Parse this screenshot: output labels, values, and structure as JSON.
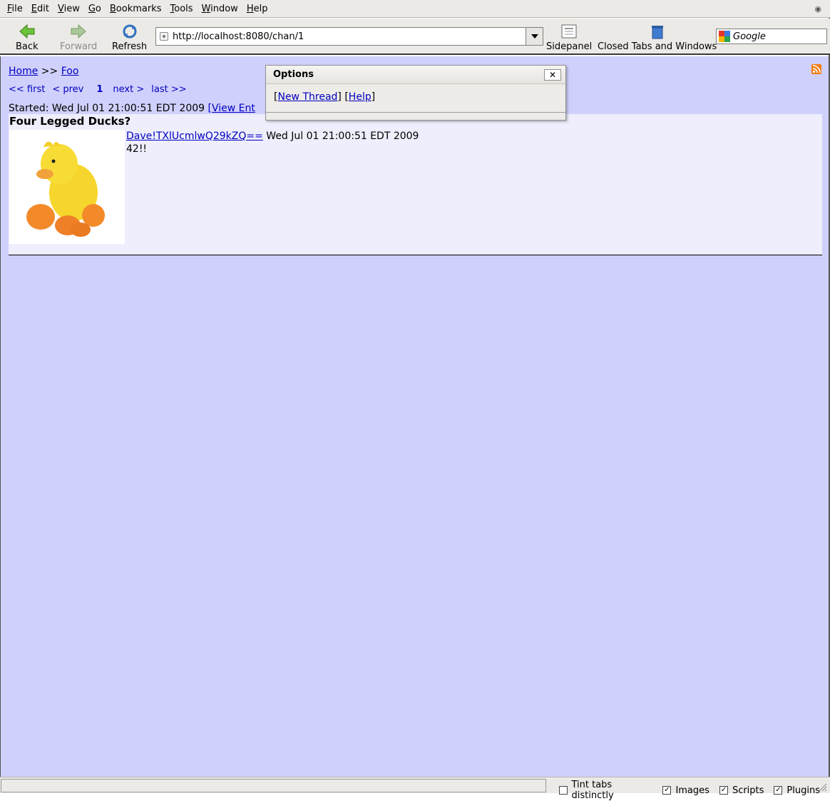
{
  "menubar": {
    "items": [
      {
        "key": "F",
        "rest": "ile"
      },
      {
        "key": "E",
        "rest": "dit"
      },
      {
        "key": "V",
        "rest": "iew"
      },
      {
        "key": "G",
        "rest": "o"
      },
      {
        "key": "B",
        "rest": "ookmarks"
      },
      {
        "key": "T",
        "rest": "ools"
      },
      {
        "key": "W",
        "rest": "indow"
      },
      {
        "key": "H",
        "rest": "elp"
      }
    ]
  },
  "toolbar": {
    "back_label": "Back",
    "forward_label": "Forward",
    "refresh_label": "Refresh",
    "url": "http://localhost:8080/chan/1",
    "sidepanel_label": "Sidepanel",
    "closed_tabs_label": "Closed Tabs and Windows",
    "search_placeholder": "Google"
  },
  "page": {
    "breadcrumb": {
      "home": "Home",
      "sep": ">>",
      "board": "Foo"
    },
    "pager": {
      "first": "<< first",
      "prev": "< prev",
      "current": "1",
      "next": "next >",
      "last": "last >>"
    },
    "started_label": "Started:",
    "started_date": "Wed Jul 01 21:00:51 EDT 2009",
    "view_entire_partial": "[View Ent",
    "thread": {
      "title": "Four Legged Ducks?",
      "author": "Dave!TXlUcmlwQ29kZQ==",
      "date": "Wed Jul 01 21:00:51 EDT 2009",
      "body": "42!!"
    }
  },
  "dialog": {
    "title": "Options",
    "close_label": "✕",
    "new_thread": "New Thread",
    "help": "Help"
  },
  "statusbar": {
    "tint_tabs": "Tint tabs distinctly",
    "images": "Images",
    "scripts": "Scripts",
    "plugins": "Plugins"
  },
  "colors": {
    "page_bg": "#d0d0fc",
    "thread_bg": "#eeeefc",
    "link": "#0000c0",
    "chrome_bg": "#eceae6"
  }
}
